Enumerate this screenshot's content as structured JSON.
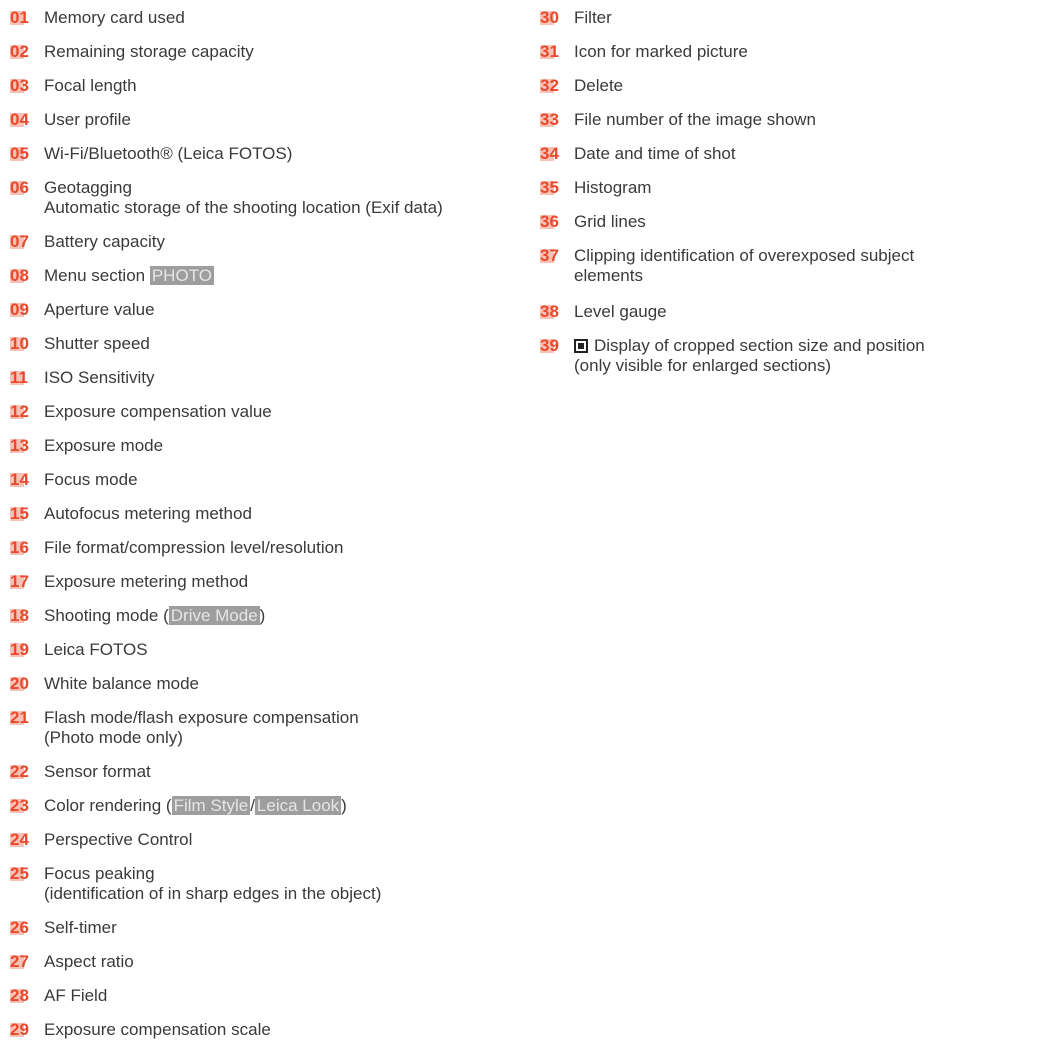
{
  "colors": {
    "number": "#e8492d",
    "number_bg": "#f7c2b5",
    "tag_bg": "#9e9e9e",
    "text": "#3a3a3a"
  },
  "left": [
    {
      "num": "01",
      "line1": "Memory card used"
    },
    {
      "num": "02",
      "line1": "Remaining storage capacity"
    },
    {
      "num": "03",
      "line1": "Focal length"
    },
    {
      "num": "04",
      "line1": "User profile"
    },
    {
      "num": "05",
      "line1": "Wi-Fi/Bluetooth® (Leica FOTOS)"
    },
    {
      "num": "06",
      "line1": "Geotagging",
      "line2": "Automatic storage of the shooting location (Exif data)"
    },
    {
      "num": "07",
      "line1": "Battery capacity"
    },
    {
      "num": "08",
      "pre": "Menu section ",
      "tag": "PHOTO"
    },
    {
      "num": "09",
      "line1": "Aperture value"
    },
    {
      "num": "10",
      "line1": "Shutter speed"
    },
    {
      "num": "11",
      "line1": "ISO Sensitivity"
    },
    {
      "num": "12",
      "line1": "Exposure compensation value"
    },
    {
      "num": "13",
      "line1": "Exposure mode"
    },
    {
      "num": "14",
      "line1": "Focus mode"
    },
    {
      "num": "15",
      "line1": "Autofocus metering method"
    },
    {
      "num": "16",
      "line1": "File format/compression level/resolution"
    },
    {
      "num": "17",
      "line1": "Exposure metering method"
    },
    {
      "num": "18",
      "pre": "Shooting mode (",
      "tag": "Drive Mode",
      "post": ")"
    },
    {
      "num": "19",
      "line1": "Leica FOTOS"
    },
    {
      "num": "20",
      "line1": "White balance mode"
    },
    {
      "num": "21",
      "line1": "Flash mode/flash exposure compensation",
      "line2": "(Photo mode only)"
    },
    {
      "num": "22",
      "line1": "Sensor format"
    },
    {
      "num": "23",
      "pre": "Color rendering (",
      "tag": "Film Style",
      "mid": "/",
      "tag2": "Leica Look",
      "post": ")"
    },
    {
      "num": "24",
      "line1": "Perspective Control"
    },
    {
      "num": "25",
      "line1": "Focus peaking",
      "line2": "(identification of in sharp edges in the object)"
    },
    {
      "num": "26",
      "line1": "Self-timer"
    },
    {
      "num": "27",
      "line1": "Aspect ratio"
    },
    {
      "num": "28",
      "line1": "AF Field"
    },
    {
      "num": "29",
      "line1": "Exposure compensation scale"
    }
  ],
  "right": [
    {
      "num": "30",
      "line1": "Filter"
    },
    {
      "num": "31",
      "line1": "Icon for marked picture"
    },
    {
      "num": "32",
      "line1": "Delete"
    },
    {
      "num": "33",
      "line1": "File number of the image shown"
    },
    {
      "num": "34",
      "line1": "Date and time of shot"
    },
    {
      "num": "35",
      "line1": "Histogram"
    },
    {
      "num": "36",
      "line1": "Grid lines"
    },
    {
      "num": "37",
      "line1": "Clipping identification of overexposed subject",
      "line2": "elements"
    },
    {
      "num": "38",
      "line1": "Level gauge"
    },
    {
      "num": "39",
      "line1": "Display of cropped section size and position",
      "line2": "(only visible for enlarged sections)",
      "icon": "crop-section-icon"
    }
  ]
}
